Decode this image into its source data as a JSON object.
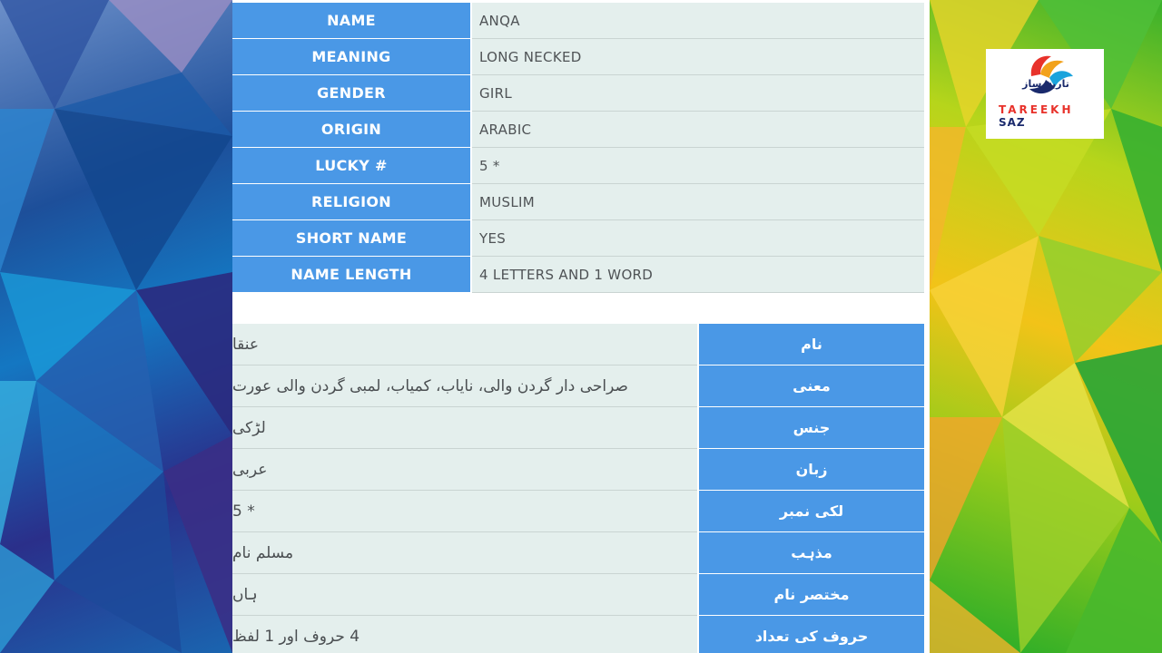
{
  "english_table": {
    "rows": [
      {
        "label": "NAME",
        "value": "ANQA"
      },
      {
        "label": "MEANING",
        "value": "LONG NECKED"
      },
      {
        "label": "GENDER",
        "value": "GIRL"
      },
      {
        "label": "ORIGIN",
        "value": "ARABIC"
      },
      {
        "label": "LUCKY #",
        "value": "5 *"
      },
      {
        "label": "RELIGION",
        "value": "MUSLIM"
      },
      {
        "label": "SHORT NAME",
        "value": "YES"
      },
      {
        "label": "NAME LENGTH",
        "value": "4 LETTERS AND 1 WORD"
      }
    ]
  },
  "urdu_table": {
    "rows": [
      {
        "label": "نام",
        "value": "عنقا"
      },
      {
        "label": "معنی",
        "value": "صراحی دار گردن والی، نایاب، کمیاب، لمبی گردن والی عورت"
      },
      {
        "label": "جنس",
        "value": "لڑکی"
      },
      {
        "label": "زبان",
        "value": "عربی"
      },
      {
        "label": "لکی نمبر",
        "value": "5 *"
      },
      {
        "label": "مذہب",
        "value": "مسلم نام"
      },
      {
        "label": "مختصر نام",
        "value": "ہاں"
      },
      {
        "label": "حروف کی تعداد",
        "value": "4 حروف اور 1 لفظ"
      }
    ]
  },
  "logo": {
    "urdu_text": "تاریخ ساز",
    "brand_prefix": "TAREEKH",
    "brand_suffix": "SAZ"
  },
  "colors": {
    "label_bg": "#4a98e6",
    "value_bg": "#e4efed"
  }
}
